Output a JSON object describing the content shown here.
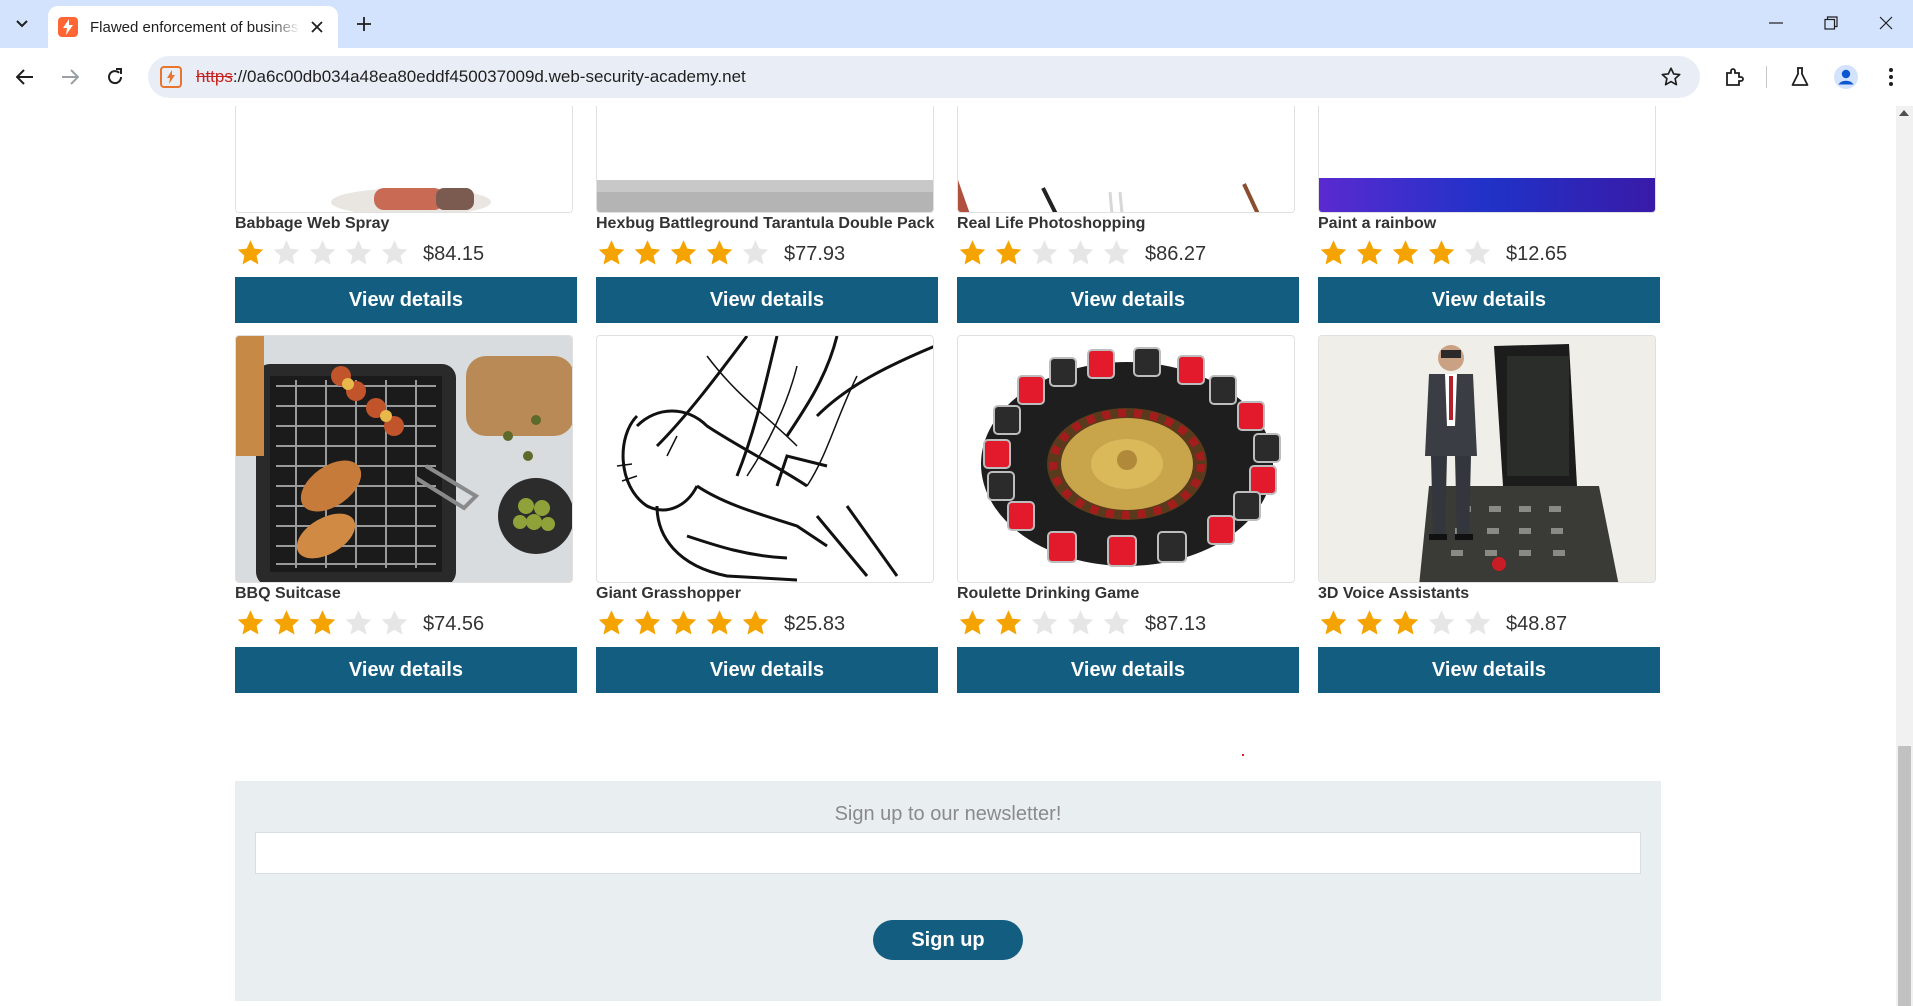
{
  "browser": {
    "tab_title": "Flawed enforcement of business rules",
    "url_scheme": "https",
    "url_rest": "://0a6c00db034a48ea80eddf450037009d.web-security-academy.net",
    "icons": [
      "tab-list-icon",
      "lightning-favicon-icon",
      "close-icon",
      "plus-icon",
      "minimize-icon",
      "restore-icon",
      "close-window-icon",
      "back-icon",
      "forward-icon",
      "reload-icon",
      "bookmark-star-icon",
      "extensions-icon",
      "labs-flask-icon",
      "profile-icon",
      "kebab-menu-icon"
    ]
  },
  "colors": {
    "star_on": "#f5a300",
    "star_off": "#e6e6e6",
    "button": "#135d80",
    "newsletter_bg": "#e9eef1"
  },
  "products_row1": [
    {
      "name": "Babbage Web Spray",
      "stars": 1,
      "price": "$84.15",
      "button": "View details"
    },
    {
      "name": "Hexbug Battleground Tarantula Double Pack",
      "stars": 4,
      "price": "$77.93",
      "button": "View details"
    },
    {
      "name": "Real Life Photoshopping",
      "stars": 2,
      "price": "$86.27",
      "button": "View details"
    },
    {
      "name": "Paint a rainbow",
      "stars": 4,
      "price": "$12.65",
      "button": "View details"
    }
  ],
  "products_row2": [
    {
      "name": "BBQ Suitcase",
      "stars": 3,
      "price": "$74.56",
      "button": "View details"
    },
    {
      "name": "Giant Grasshopper",
      "stars": 5,
      "price": "$25.83",
      "button": "View details"
    },
    {
      "name": "Roulette Drinking Game",
      "stars": 2,
      "price": "$87.13",
      "button": "View details"
    },
    {
      "name": "3D Voice Assistants",
      "stars": 3,
      "price": "$48.87",
      "button": "View details"
    }
  ],
  "newsletter": {
    "heading": "Sign up to our newsletter!",
    "email_value": "",
    "button": "Sign up"
  }
}
